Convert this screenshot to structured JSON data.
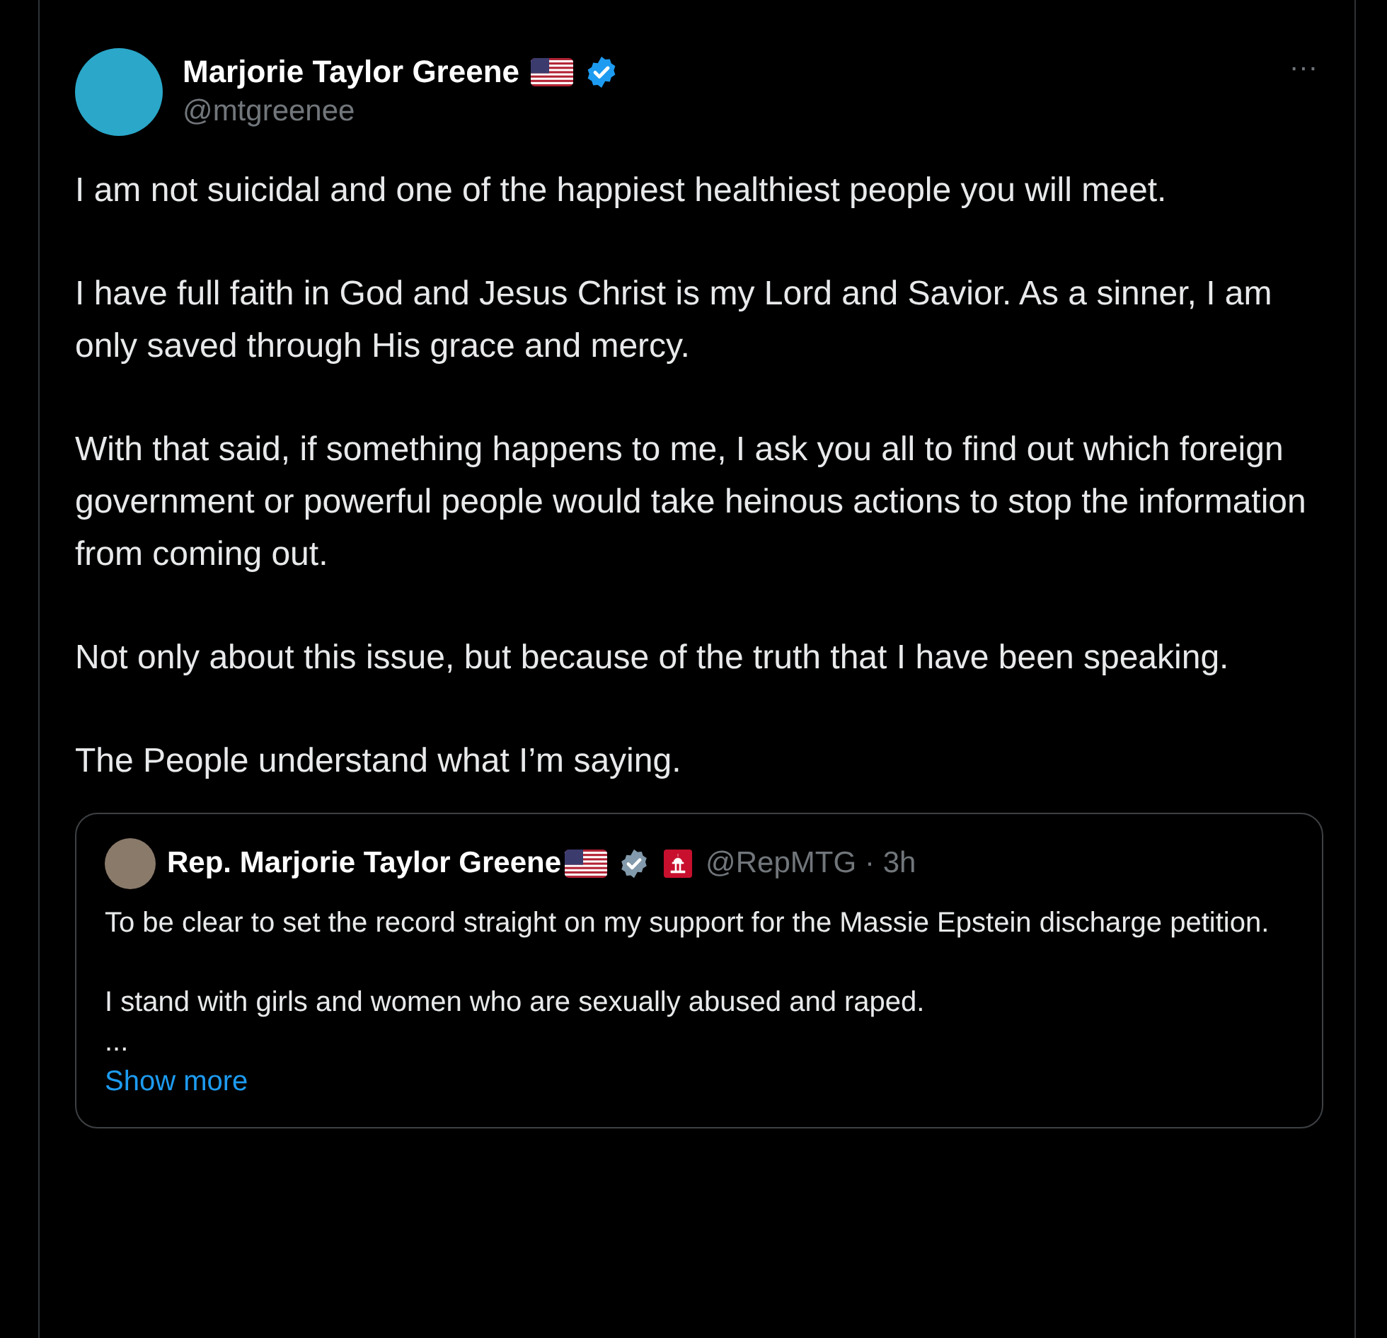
{
  "post": {
    "author": {
      "name": "Marjorie Taylor Greene",
      "handle": "@mtgreenee"
    },
    "more": "···",
    "paragraphs": [
      "I am not suicidal and one of the happiest healthiest people you will meet.",
      "I have full faith in God and Jesus Christ is my Lord and Savior. As a sinner, I am only saved through His grace and mercy.",
      "With that said, if something happens to me, I ask you all to find out which foreign government or powerful people would take heinous actions to stop the information from coming out.",
      "Not only about this issue, but because of the truth that I have been speaking.",
      "The People understand what I’m saying."
    ],
    "quote": {
      "author": {
        "name": "Rep. Marjorie Taylor Greene",
        "handle": "@RepMTG",
        "time": "· 3h"
      },
      "paragraphs": [
        "To be clear to set the record straight on my support for the Massie Epstein discharge petition.",
        "I stand with girls and women who are sexually abused and raped.",
        "..."
      ],
      "show_more": "Show more"
    }
  }
}
